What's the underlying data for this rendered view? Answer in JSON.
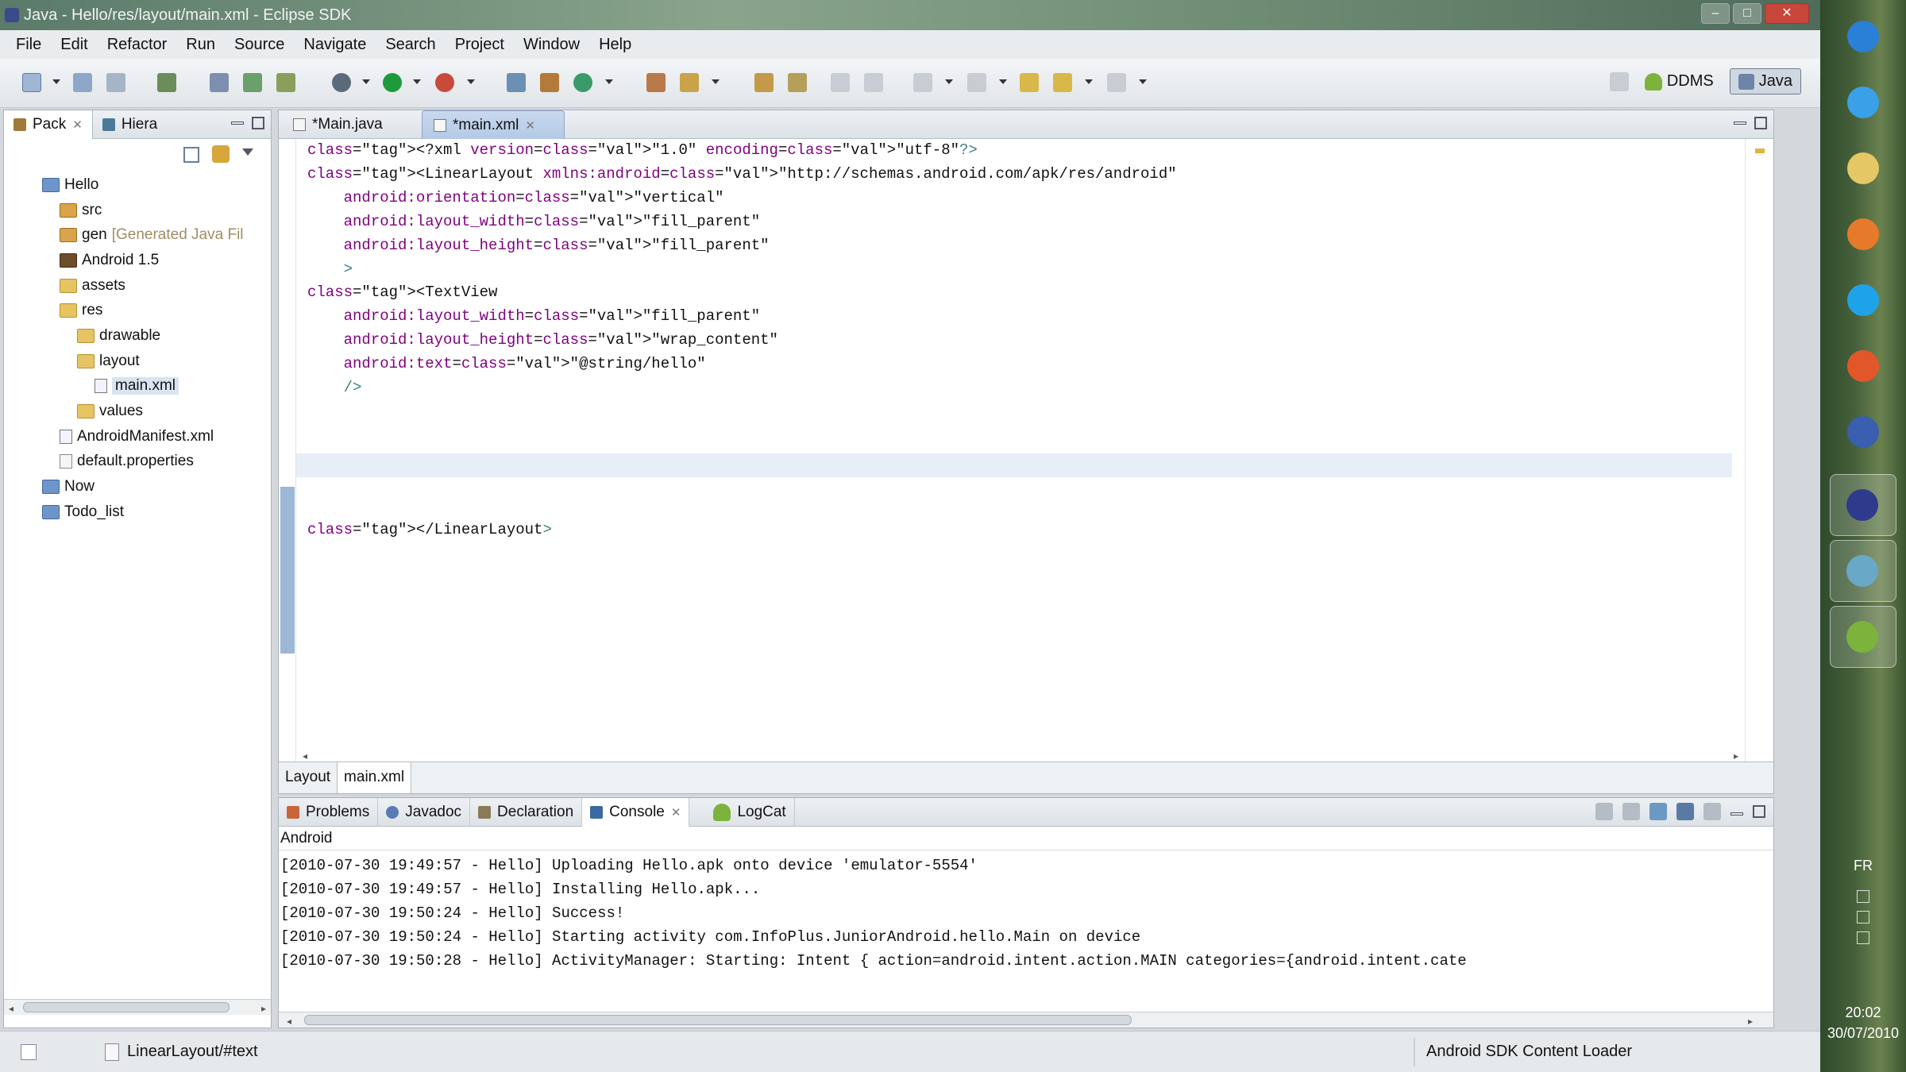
{
  "window": {
    "title": "Java - Hello/res/layout/main.xml - Eclipse SDK"
  },
  "menu": [
    "File",
    "Edit",
    "Refactor",
    "Run",
    "Source",
    "Navigate",
    "Search",
    "Project",
    "Window",
    "Help"
  ],
  "perspectives": {
    "ddms": "DDMS",
    "java": "Java"
  },
  "left_panel": {
    "tabs": [
      {
        "label": "Pack"
      },
      {
        "label": "Hiera"
      }
    ],
    "tree": [
      {
        "label": "Hello",
        "indent": 0,
        "icon": "project-icon"
      },
      {
        "label": "src",
        "indent": 1,
        "icon": "package-folder-icon"
      },
      {
        "label": "gen",
        "suffix": "[Generated Java Fil",
        "indent": 1,
        "icon": "package-folder-icon"
      },
      {
        "label": "Android 1.5",
        "indent": 1,
        "icon": "library-icon"
      },
      {
        "label": "assets",
        "indent": 1,
        "icon": "folder-icon"
      },
      {
        "label": "res",
        "indent": 1,
        "icon": "folder-icon"
      },
      {
        "label": "drawable",
        "indent": 2,
        "icon": "folder-icon"
      },
      {
        "label": "layout",
        "indent": 2,
        "icon": "folder-icon"
      },
      {
        "label": "main.xml",
        "indent": 3,
        "icon": "xml-file-icon",
        "selected": true
      },
      {
        "label": "values",
        "indent": 2,
        "icon": "folder-icon"
      },
      {
        "label": "AndroidManifest.xml",
        "indent": 1,
        "icon": "xml-file-icon"
      },
      {
        "label": "default.properties",
        "indent": 1,
        "icon": "file-icon"
      },
      {
        "label": "Now",
        "indent": 0,
        "icon": "project-icon"
      },
      {
        "label": "Todo_list",
        "indent": 0,
        "icon": "project-icon"
      }
    ]
  },
  "editor": {
    "tabs": [
      {
        "label": "*Main.java"
      },
      {
        "label": "*main.xml",
        "active": true
      }
    ],
    "code_lines": [
      "<?xml version=\"1.0\" encoding=\"utf-8\"?>",
      "<LinearLayout xmlns:android=\"http://schemas.android.com/apk/res/android\"",
      "    android:orientation=\"vertical\"",
      "    android:layout_width=\"fill_parent\"",
      "    android:layout_height=\"fill_parent\"",
      "    >",
      "<TextView",
      "    android:layout_width=\"fill_parent\"",
      "    android:layout_height=\"wrap_content\"",
      "    android:text=\"@string/hello\"",
      "    />",
      "",
      "",
      "",
      "",
      "",
      "</LinearLayout>"
    ],
    "bottom_tabs": [
      {
        "label": "Layout"
      },
      {
        "label": "main.xml",
        "active": true
      }
    ]
  },
  "console": {
    "tabs": [
      {
        "label": "Problems"
      },
      {
        "label": "Javadoc"
      },
      {
        "label": "Declaration"
      },
      {
        "label": "Console",
        "active": true
      },
      {
        "label": "LogCat"
      }
    ],
    "title": "Android",
    "lines": [
      "[2010-07-30 19:49:57 - Hello] Uploading Hello.apk onto device 'emulator-5554'",
      "[2010-07-30 19:49:57 - Hello] Installing Hello.apk...",
      "[2010-07-30 19:50:24 - Hello] Success!",
      "[2010-07-30 19:50:24 - Hello] Starting activity com.InfoPlus.JuniorAndroid.hello.Main on device",
      "[2010-07-30 19:50:28 - Hello] ActivityManager: Starting: Intent { action=android.intent.action.MAIN categories={android.intent.cate"
    ]
  },
  "status": {
    "left": "LinearLayout/#text",
    "right": "Android SDK Content Loader"
  },
  "taskbar": {
    "language": "FR",
    "time": "20:02",
    "date": "30/07/2010",
    "apps": [
      {
        "name": "windows-start-icon",
        "color": "#2a7fd6"
      },
      {
        "name": "internet-explorer-icon",
        "color": "#3aa0e8"
      },
      {
        "name": "file-explorer-icon",
        "color": "#e6c766"
      },
      {
        "name": "media-player-icon",
        "color": "#e67a2a"
      },
      {
        "name": "skype-icon",
        "color": "#1fa3e8"
      },
      {
        "name": "firefox-icon",
        "color": "#e2572a"
      },
      {
        "name": "link-app-icon",
        "color": "#3a5fae"
      },
      {
        "name": "eclipse-icon",
        "color": "#2e3a8c"
      },
      {
        "name": "users-icon",
        "color": "#6aa8c8"
      },
      {
        "name": "android-emulator-icon",
        "color": "#7bb33c"
      }
    ]
  }
}
